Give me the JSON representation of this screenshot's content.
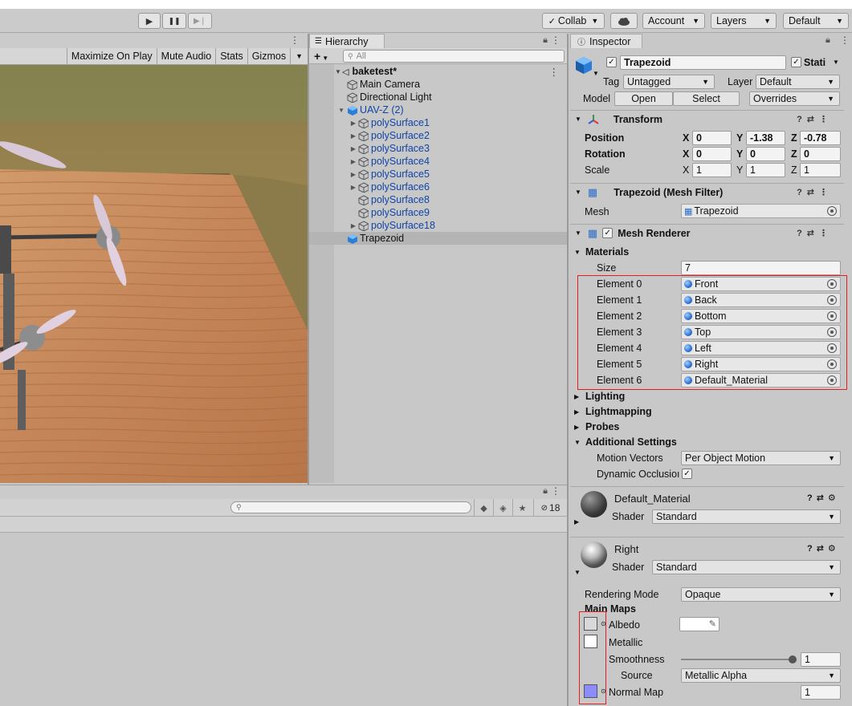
{
  "toolbar": {
    "play": "▶",
    "pause": "❚❚",
    "step": "▶❘",
    "collab": "Collab",
    "account": "Account",
    "layers": "Layers",
    "layout": "Default"
  },
  "game_view": {
    "buttons": [
      "Maximize On Play",
      "Mute Audio",
      "Stats",
      "Gizmos"
    ]
  },
  "hierarchy": {
    "tab": "Hierarchy",
    "search_placeholder": "All",
    "scene": "baketest*",
    "items": [
      {
        "label": "Main Camera",
        "indent": 1,
        "arrow": "",
        "blue": false
      },
      {
        "label": "Directional Light",
        "indent": 1,
        "arrow": "",
        "blue": false
      },
      {
        "label": "UAV-Z (2)",
        "indent": 1,
        "arrow": "▼",
        "blue": true
      },
      {
        "label": "polySurface1",
        "indent": 2,
        "arrow": "▶",
        "blue": true
      },
      {
        "label": "polySurface2",
        "indent": 2,
        "arrow": "▶",
        "blue": true
      },
      {
        "label": "polySurface3",
        "indent": 2,
        "arrow": "▶",
        "blue": true
      },
      {
        "label": "polySurface4",
        "indent": 2,
        "arrow": "▶",
        "blue": true
      },
      {
        "label": "polySurface5",
        "indent": 2,
        "arrow": "▶",
        "blue": true
      },
      {
        "label": "polySurface6",
        "indent": 2,
        "arrow": "▶",
        "blue": true
      },
      {
        "label": "polySurface8",
        "indent": 2,
        "arrow": "",
        "blue": true
      },
      {
        "label": "polySurface9",
        "indent": 2,
        "arrow": "",
        "blue": true
      },
      {
        "label": "polySurface18",
        "indent": 2,
        "arrow": "▶",
        "blue": true
      },
      {
        "label": "Trapezoid",
        "indent": 1,
        "arrow": "",
        "blue": false,
        "selected": true
      }
    ]
  },
  "console": {
    "hidden_count": "18"
  },
  "inspector": {
    "tab": "Inspector",
    "object_name": "Trapezoid",
    "static_label": "Stati",
    "tag_label": "Tag",
    "tag_value": "Untagged",
    "layer_label": "Layer",
    "layer_value": "Default",
    "model_label": "Model",
    "open": "Open",
    "select": "Select",
    "overrides": "Overrides",
    "transform": {
      "title": "Transform",
      "position_label": "Position",
      "rotation_label": "Rotation",
      "scale_label": "Scale",
      "position": {
        "x": "0",
        "y": "-1.38",
        "z": "-0.78"
      },
      "rotation": {
        "x": "0",
        "y": "0",
        "z": "0"
      },
      "scale": {
        "x": "1",
        "y": "1",
        "z": "1"
      }
    },
    "mesh_filter": {
      "title": "Trapezoid (Mesh Filter)",
      "mesh_label": "Mesh",
      "mesh_value": "Trapezoid"
    },
    "mesh_renderer": {
      "title": "Mesh Renderer",
      "materials_label": "Materials",
      "size_label": "Size",
      "size_value": "7",
      "elements": [
        {
          "label": "Element 0",
          "value": "Front"
        },
        {
          "label": "Element 1",
          "value": "Back"
        },
        {
          "label": "Element 2",
          "value": "Bottom"
        },
        {
          "label": "Element 3",
          "value": "Top"
        },
        {
          "label": "Element 4",
          "value": "Left"
        },
        {
          "label": "Element 5",
          "value": "Right"
        },
        {
          "label": "Element 6",
          "value": "Default_Material"
        }
      ],
      "lighting": "Lighting",
      "lightmapping": "Lightmapping",
      "probes": "Probes",
      "additional": "Additional Settings",
      "motion_label": "Motion Vectors",
      "motion_value": "Per Object Motion",
      "occlusion_label": "Dynamic Occlusioı"
    },
    "material1": {
      "name": "Default_Material",
      "shader_label": "Shader",
      "shader": "Standard"
    },
    "material2": {
      "name": "Right",
      "shader_label": "Shader",
      "shader": "Standard",
      "rendering_mode_label": "Rendering Mode",
      "rendering_mode": "Opaque",
      "main_maps": "Main Maps",
      "albedo": "Albedo",
      "metallic": "Metallic",
      "smoothness": "Smoothness",
      "smoothness_value": "1",
      "source_label": "Source",
      "source_value": "Metallic Alpha",
      "normal_map": "Normal Map",
      "normal_value": "1",
      "normal_color": "#8c8cff"
    }
  }
}
